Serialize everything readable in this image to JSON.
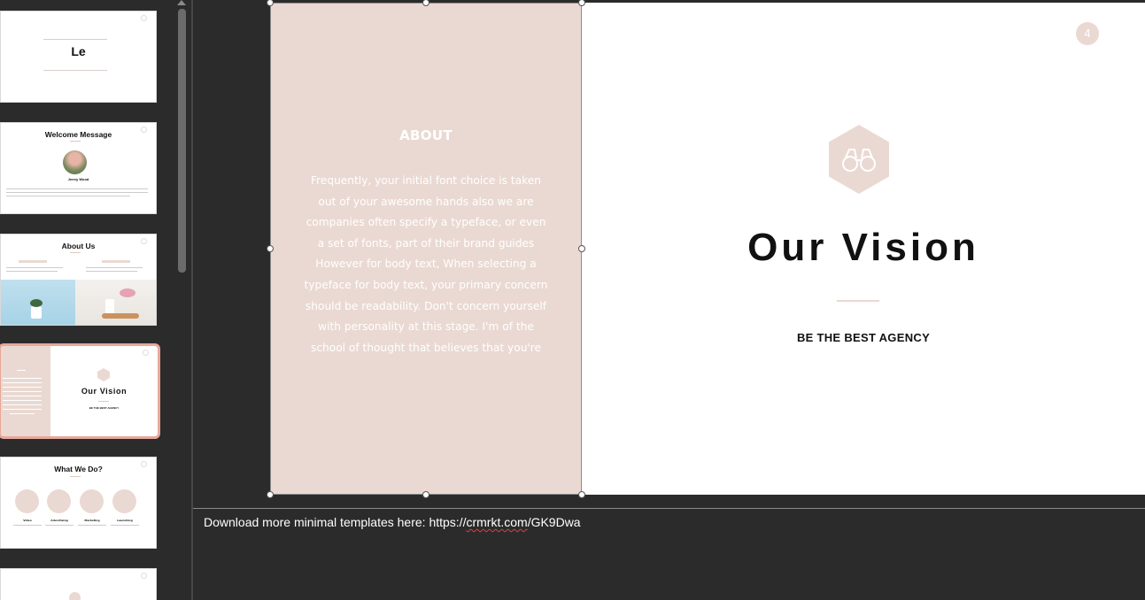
{
  "thumbnails": {
    "slide1": {
      "title": "Le"
    },
    "slide2": {
      "title": "Welcome Message",
      "name": "Jenny Wood"
    },
    "slide3": {
      "title": "About Us"
    },
    "slide4": {
      "about": "ABOUT",
      "title": "Our Vision",
      "subtitle": "BE THE BEST AGENCY"
    },
    "slide5": {
      "title": "What We Do?",
      "items": [
        "Video",
        "Advertising",
        "Marketing",
        "Launching"
      ]
    }
  },
  "slide": {
    "about_title": "ABOUT",
    "about_body": "Frequently, your initial font choice is taken out of your awesome hands also we are companies often specify a typeface, or even a set of fonts,  part of their brand guides However for body text, When selecting a typeface for body text, your primary concern should be readability. Don't concern yourself with personality at this stage. I'm of the school of thought that believes that you're",
    "page_number": "4",
    "icon": "binoculars-icon",
    "title": "Our Vision",
    "subtitle": "BE THE BEST AGENCY"
  },
  "notes": {
    "prefix": "Download more minimal templates here: https://",
    "misspelled": "crmrkt.com",
    "suffix": "/GK9Dwa"
  },
  "colors": {
    "accent_blush": "#ead9d2",
    "selection_outline": "#e8a79a",
    "app_background": "#2b2b2b"
  }
}
